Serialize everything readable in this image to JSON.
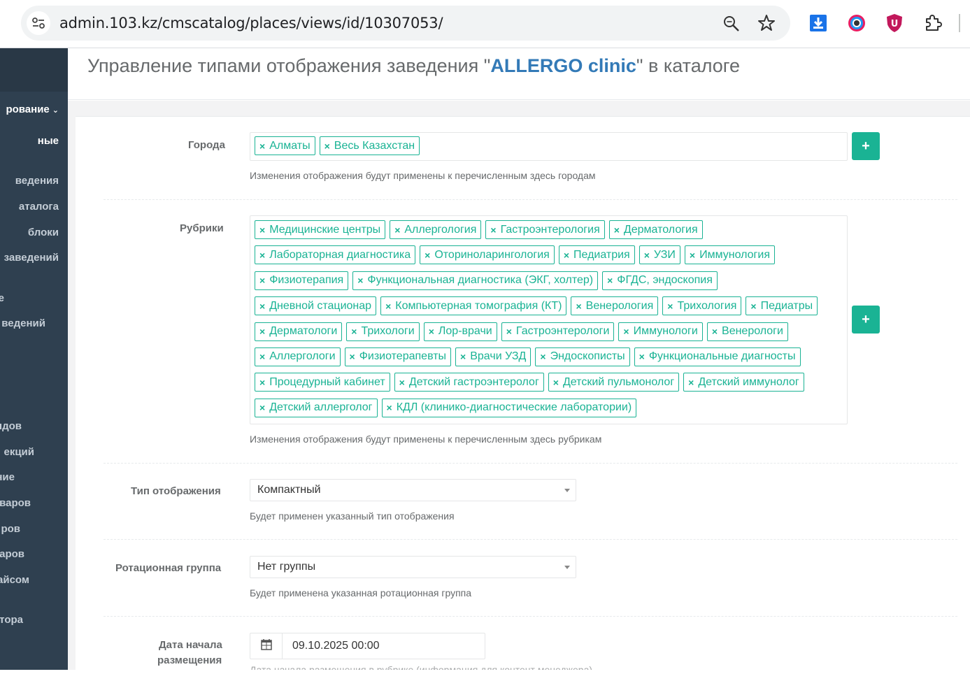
{
  "browser": {
    "url": "admin.103.kz/cmscatalog/places/views/id/10307053/"
  },
  "sidebar": {
    "items": [
      {
        "label": "рование",
        "chevron": true
      },
      {
        "label": "ные"
      },
      {
        "label": "ведения"
      },
      {
        "label": "аталога"
      },
      {
        "label": "блоки"
      },
      {
        "label": "заведений"
      },
      {
        "label": "е"
      },
      {
        "label": "ведений"
      },
      {
        "label": "ндов"
      },
      {
        "label": "екций"
      },
      {
        "label": "ние"
      },
      {
        "label": "варов"
      },
      {
        "label": "ров"
      },
      {
        "label": "аров"
      },
      {
        "label": "айсом"
      },
      {
        "label": "тора"
      }
    ]
  },
  "header": {
    "title_prefix": "Управление типами отображения заведения \"",
    "clinic_name": "ALLERGO clinic",
    "title_suffix": "\" в каталоге"
  },
  "form": {
    "cities": {
      "label": "Города",
      "tags": [
        "Алматы",
        "Весь Казахстан"
      ],
      "help": "Изменения отображения будут применены к перечисленным здесь городам",
      "add_label": "+"
    },
    "rubrics": {
      "label": "Рубрики",
      "tags": [
        "Медицинские центры",
        "Аллергология",
        "Гастроэнтерология",
        "Дерматология",
        "Лабораторная диагностика",
        "Оториноларингология",
        "Педиатрия",
        "УЗИ",
        "Иммунология",
        "Физиотерапия",
        "Функциональная диагностика (ЭКГ, холтер)",
        "ФГДС, эндоскопия",
        "Дневной стационар",
        "Компьютерная томография (КТ)",
        "Венерология",
        "Трихология",
        "Педиатры",
        "Дерматологи",
        "Трихологи",
        "Лор-врачи",
        "Гастроэнтерологи",
        "Иммунологи",
        "Венерологи",
        "Аллергологи",
        "Физиотерапевты",
        "Врачи УЗД",
        "Эндоскописты",
        "Функциональные диагносты",
        "Процедурный кабинет",
        "Детский гастроэнтеролог",
        "Детский пульмонолог",
        "Детский иммунолог",
        "Детский аллерголог",
        "КДЛ (клинико-диагностические лаборатории)"
      ],
      "help": "Изменения отображения будут применены к перечисленным здесь рубрикам",
      "add_label": "+"
    },
    "display_type": {
      "label": "Тип отображения",
      "value": "Компактный",
      "help": "Будет применен указанный тип отображения"
    },
    "rotation_group": {
      "label": "Ротационная группа",
      "value": "Нет группы",
      "help": "Будет применена указанная ротационная группа"
    },
    "start_date": {
      "label_line1": "Дата начала",
      "label_line2": "размещения",
      "value": "09.10.2025 00:00",
      "help": "Дата начала размещения в рубрике (информация для контент менеджера)"
    }
  },
  "colors": {
    "accent": "#1ab394",
    "sidebar": "#2f4050",
    "link": "#337ab7"
  }
}
